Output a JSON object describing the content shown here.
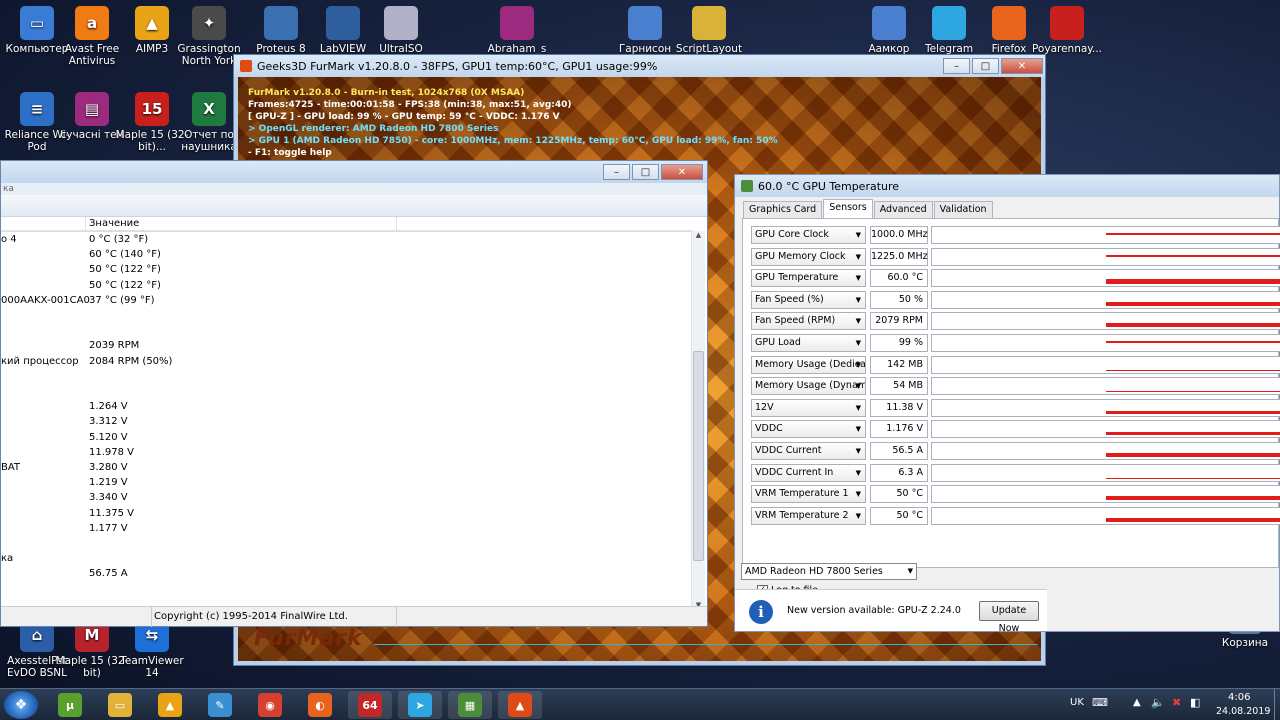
{
  "desktop": {
    "icons": [
      {
        "label": "Компьютер",
        "glyph": "▭",
        "color": "#3a7bd5"
      },
      {
        "label": "Avast Free Antivirus",
        "glyph": "a",
        "color": "#f07a13"
      },
      {
        "label": "AIMP3",
        "glyph": "▲",
        "color": "#e8a316"
      },
      {
        "label": "Grassington North York",
        "glyph": "✦",
        "color": "#4a4a4a"
      },
      {
        "label": "Reliance Wi-Pod",
        "glyph": "≡",
        "color": "#2d6fc4"
      },
      {
        "label": "сучасні тен",
        "glyph": "▤",
        "color": "#9c2a7e"
      },
      {
        "label": "Maple 15 (32-bit)...",
        "glyph": "15",
        "color": "#c8201c"
      },
      {
        "label": "Отчет по наушника",
        "glyph": "X",
        "color": "#1f7a3f"
      },
      {
        "label": "AxesstelPst EvDO BSNL",
        "glyph": "⌂",
        "color": "#2c5ea8"
      },
      {
        "label": "Maple 15 (32-bit)",
        "glyph": "M",
        "color": "#b8222a"
      },
      {
        "label": "TeamViewer 14",
        "glyph": "⇆",
        "color": "#1e6fd9"
      },
      {
        "label": "Корзина",
        "glyph": "🗑",
        "color": "#5b7b9c"
      }
    ],
    "partial_labels": [
      "Proteus 8",
      "LabVIEW",
      "UltraISO",
      "Abraham_s",
      "Гарнисон",
      "ScriptLayout",
      "Аамкор",
      "Telegram",
      "Firefox",
      "Poyarennay..."
    ]
  },
  "furmark": {
    "title": "Geeks3D FurMark v1.20.8.0 - 38FPS, GPU1 temp:60°C, GPU1 usage:99%",
    "lines": [
      {
        "text": "FurMark v1.20.8.0 - Burn-in test, 1024x768 (0X MSAA)",
        "color": "#ffe95a"
      },
      {
        "text": "Frames:4725 - time:00:01:58 - FPS:38 (min:38, max:51, avg:40)",
        "color": "#ffffff"
      },
      {
        "text": "[ GPU-Z ] - GPU load: 99 % - GPU temp: 59 °C - VDDC: 1.176 V",
        "color": "#ffffff"
      },
      {
        "text": "> OpenGL renderer: AMD Radeon HD 7800 Series",
        "color": "#6ee0ff"
      },
      {
        "text": "> GPU 1 (AMD Radeon HD 7850) - core: 1000MHz, mem: 1225MHz, temp: 60°C, GPU load: 99%, fan: 50%",
        "color": "#6ee0ff"
      },
      {
        "text": "- F1: toggle help",
        "color": "#ffffff"
      }
    ],
    "logo": "FurMark"
  },
  "aida": {
    "header_fragment": "ка",
    "column_value": "Значение",
    "rows": [
      {
        "name": "о 4",
        "value": "0 °C  (32 °F)"
      },
      {
        "name": "",
        "value": "60 °C  (140 °F)"
      },
      {
        "name": "",
        "value": "50 °C  (122 °F)"
      },
      {
        "name": "",
        "value": "50 °C  (122 °F)"
      },
      {
        "name": "000AAKX-001CA0",
        "value": "37 °C  (99 °F)"
      },
      {
        "name": "",
        "value": ""
      },
      {
        "name": "",
        "value": ""
      },
      {
        "name": "",
        "value": "2039 RPM"
      },
      {
        "name": "кий процессор",
        "value": "2084 RPM  (50%)"
      },
      {
        "name": "",
        "value": ""
      },
      {
        "name": "",
        "value": ""
      },
      {
        "name": "",
        "value": "1.264 V"
      },
      {
        "name": "",
        "value": "3.312 V"
      },
      {
        "name": "",
        "value": "5.120 V"
      },
      {
        "name": "",
        "value": "11.978 V"
      },
      {
        "name": "BAT",
        "value": "3.280 V"
      },
      {
        "name": "",
        "value": "1.219 V"
      },
      {
        "name": "",
        "value": "3.340 V"
      },
      {
        "name": "",
        "value": "11.375 V"
      },
      {
        "name": "",
        "value": "1.177 V"
      },
      {
        "name": "",
        "value": ""
      },
      {
        "name": "ка",
        "value": ""
      },
      {
        "name": "",
        "value": "56.75 A"
      }
    ],
    "status": "Copyright (c) 1995-2014 FinalWire Ltd."
  },
  "gpuz": {
    "title": "60.0 °C GPU Temperature",
    "tabs": [
      "Graphics Card",
      "Sensors",
      "Advanced",
      "Validation"
    ],
    "active_tab": "Sensors",
    "sensors": [
      {
        "name": "GPU Core Clock",
        "value": "1000.0 MHz",
        "level": 0.95
      },
      {
        "name": "GPU Memory Clock",
        "value": "1225.0 MHz",
        "level": 0.95
      },
      {
        "name": "GPU Temperature",
        "value": "60.0 °C",
        "level": 0.6
      },
      {
        "name": "Fan Speed (%)",
        "value": "50 %",
        "level": 0.5
      },
      {
        "name": "Fan Speed (RPM)",
        "value": "2079 RPM",
        "level": 0.5
      },
      {
        "name": "GPU Load",
        "value": "99 %",
        "level": 0.99
      },
      {
        "name": "Memory Usage (Dedicated)",
        "value": "142 MB",
        "level": 0.07
      },
      {
        "name": "Memory Usage (Dynamic)",
        "value": "54 MB",
        "level": 0.03
      },
      {
        "name": "12V",
        "value": "11.38 V",
        "level": 0.4
      },
      {
        "name": "VDDC",
        "value": "1.176 V",
        "level": 0.4
      },
      {
        "name": "VDDC Current",
        "value": "56.5 A",
        "level": 0.5
      },
      {
        "name": "VDDC Current In",
        "value": "6.3 A",
        "level": 0.1
      },
      {
        "name": "VRM Temperature 1",
        "value": "50 °C",
        "level": 0.5
      },
      {
        "name": "VRM Temperature 2",
        "value": "50 °C",
        "level": 0.5
      }
    ],
    "log_label": "Log to file",
    "gpu_select": "AMD Radeon HD 7800 Series",
    "new_version": "New version available: GPU-Z 2.24.0",
    "update_button": "Update Now"
  },
  "taskbar": {
    "apps": [
      {
        "name": "utorrent",
        "glyph": "µ",
        "color": "#5aa02c"
      },
      {
        "name": "explorer",
        "glyph": "▭",
        "color": "#e0b23a"
      },
      {
        "name": "aimp",
        "glyph": "▲",
        "color": "#e8a316"
      },
      {
        "name": "paint",
        "glyph": "✎",
        "color": "#3a8fd0"
      },
      {
        "name": "chrome",
        "glyph": "◉",
        "color": "#d6402e"
      },
      {
        "name": "firefox",
        "glyph": "◐",
        "color": "#e8631c"
      },
      {
        "name": "aida64",
        "glyph": "64",
        "color": "#c0282a"
      },
      {
        "name": "telegram",
        "glyph": "➤",
        "color": "#2ea6e0"
      },
      {
        "name": "gpuz",
        "glyph": "▦",
        "color": "#4d8c3a"
      },
      {
        "name": "furmark",
        "glyph": "▲",
        "color": "#e04a14"
      }
    ],
    "lang": "UK",
    "time": "4:06",
    "date": "24.08.2019"
  }
}
